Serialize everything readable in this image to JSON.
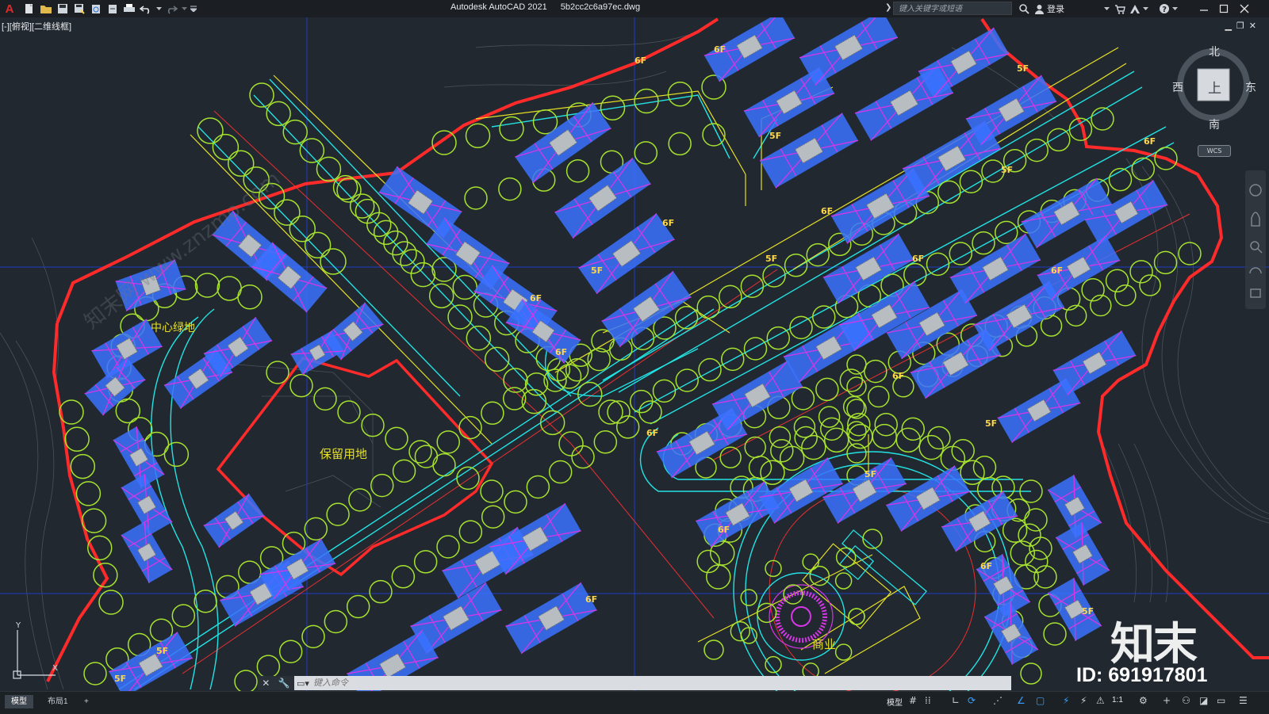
{
  "app": {
    "logo_letter": "A",
    "title": "Autodesk AutoCAD 2021",
    "filename": "5b2cc2c6a97ec.dwg"
  },
  "search": {
    "placeholder": "键入关键字或短语"
  },
  "user": {
    "login_label": "登录"
  },
  "viewport": {
    "label": "[-][俯视][二维线框]"
  },
  "viewcube": {
    "north": "北",
    "south": "南",
    "east": "东",
    "west": "西",
    "top_face": "上",
    "wcs": "WCS"
  },
  "drawing": {
    "reserved_land_label": "保留用地",
    "center_green_label": "中心绿地",
    "commercial_label": "商业",
    "floor_tags": [
      "6F",
      "6F",
      "5F",
      "6F",
      "5F",
      "5F",
      "6F",
      "6F",
      "6F",
      "6F",
      "5F",
      "6F",
      "5F",
      "6F",
      "6F",
      "5F",
      "5F",
      "6F",
      "5F",
      "6F",
      "6F",
      "5F",
      "5F",
      "6F"
    ],
    "watermark_text": "知末网 www.znzmo.com"
  },
  "command": {
    "placeholder": "键入命令"
  },
  "layout_tabs": [
    "模型",
    "布局1"
  ],
  "add_tab": "+",
  "status": {
    "model_label": "模型",
    "scale_label": "1:1"
  },
  "colors": {
    "boundary": "#ff2a2a",
    "trees": "#a6e22e",
    "roads": "#22e3e3",
    "buildings": "#3a72ff",
    "roofs": "#d636e6",
    "background": "#212830"
  },
  "overlay": {
    "brand": "知末",
    "id_text": "ID: 691917801"
  }
}
